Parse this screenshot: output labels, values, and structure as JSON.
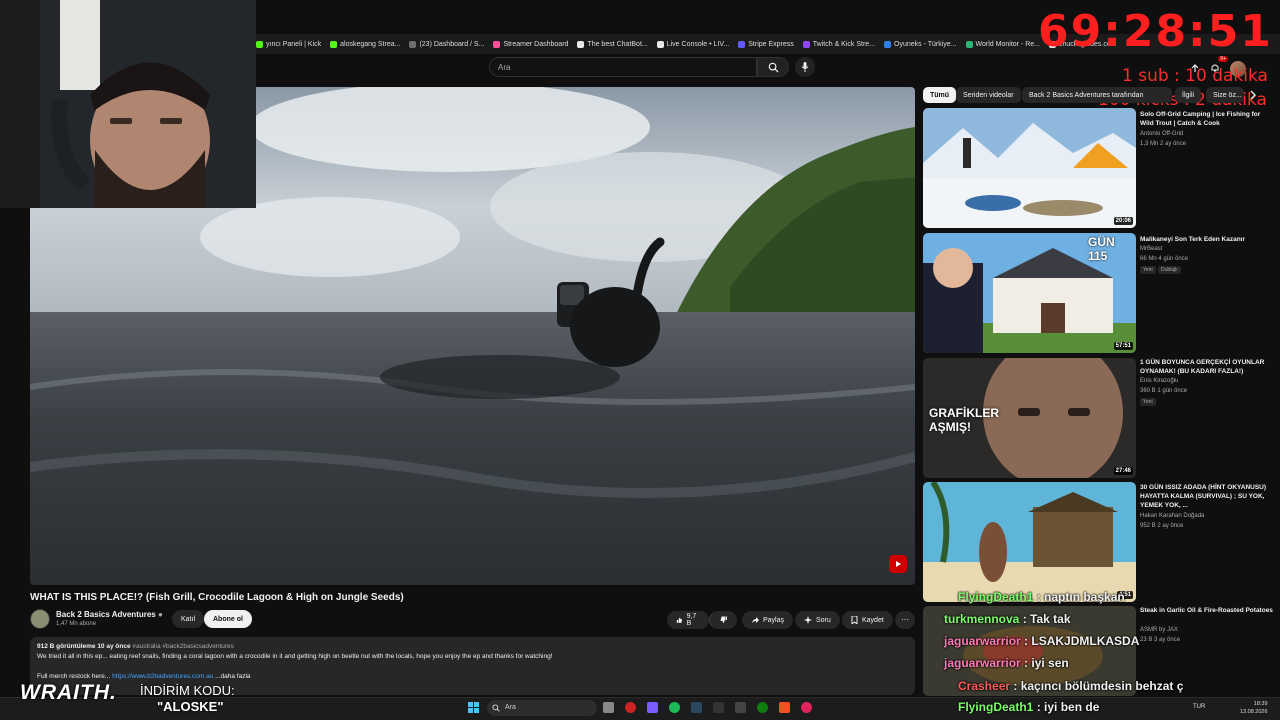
{
  "bookmarks": [
    {
      "label": "yıncı Paneli | Kick",
      "color": "#53fc18"
    },
    {
      "label": "aloskegang Strea...",
      "color": "#53fc18"
    },
    {
      "label": "(23) Dashboard / S...",
      "color": "#6e6e6e"
    },
    {
      "label": "Streamer Dashboard",
      "color": "#ff4f9a"
    },
    {
      "label": "The best ChatBot...",
      "color": "#e8e8e8"
    },
    {
      "label": "Live Console • LIV...",
      "color": "#e8e8e8"
    },
    {
      "label": "Stripe Express",
      "color": "#635bff"
    },
    {
      "label": "Twitch & Kick Stre...",
      "color": "#9146ff"
    },
    {
      "label": "Oyuneks - Türkiye...",
      "color": "#2f80ed"
    },
    {
      "label": "World Monitor - Re...",
      "color": "#2bb673"
    },
    {
      "label": "chucksguides.co...",
      "color": "#e8e8e8"
    }
  ],
  "header": {
    "search_placeholder": "Ara",
    "notif_count": "9+"
  },
  "overlay": {
    "timer": "69:28:51",
    "sub_rule": "1 sub : 10 dakika",
    "kick_rule": "100 kicks : 2 dakika",
    "sponsor": "WRAITH.",
    "promo_label": "İNDİRİM KODU:",
    "promo_code": "\"ALOSKE\""
  },
  "video": {
    "title": "WHAT IS THIS PLACE!? (Fish Grill, Crocodile Lagoon & High on Jungle Seeds)",
    "channel": "Back 2 Basics Adventures",
    "subscribers": "1,47 Mn abone",
    "join_label": "Katıl",
    "subscribe_label": "Abone ol",
    "likes": "9,7 B",
    "share_label": "Paylaş",
    "ask_label": "Soru",
    "save_label": "Kaydet",
    "views_date": "912 B görüntüleme  10 ay önce",
    "hashtags": "#australia #back2basicsadventures",
    "description_line1": "We tried it all in this ep... eating reef snails, finding a coral lagoon with a crocodile in it and getting high on beetle nut with the locals, hope you enjoy the ep and thanks for watching!",
    "description_line2_prefix": "Full merch restock here...",
    "description_link": "https://www.b2badventures.com.au",
    "more_label": "...daha fazla"
  },
  "chips": [
    "Tümü",
    "Seriden videolar",
    "Back 2 Basics Adventures tarafından",
    "İlgili",
    "Size öz..."
  ],
  "recommendations": [
    {
      "title": "Solo Off-Grid Camping | Ice Fishing for Wild Trout | Catch & Cook",
      "channel": "Antonio Off-Grid",
      "meta": "1,3 Mn  2 ay önce",
      "duration": "20:06",
      "badges": []
    },
    {
      "title": "Malikaneyi Son Terk Eden Kazanır",
      "channel": "MrBeast",
      "meta": "66 Mn  4 gün önce",
      "duration": "57:51",
      "badges": [
        "Yeni",
        "Dublajlı"
      ],
      "overlay_text": "GÜN 115"
    },
    {
      "title": "1 GÜN BOYUNCA GERÇEKÇİ OYUNLAR OYNAMAK! (BU KADARI FAZLA!)",
      "channel": "Enis Kirazoğlu",
      "meta": "360 B  1 gün önce",
      "duration": "27:46",
      "badges": [
        "Yeni"
      ],
      "overlay_text": "GRAFİKLER AŞMIŞ!"
    },
    {
      "title": "30 GÜN ISSIZ ADADA (HİNT OKYANUSU) HAYATTA KALMA (SURVIVAL) ; SU YOK, YEMEK YOK, ...",
      "channel": "Hakan Karahan Doğada",
      "meta": "952 B  2 ay önce",
      "duration": "4:51",
      "badges": []
    },
    {
      "title": "Steak in Garlic Oil & Fire-Roasted Potatoes",
      "channel": "ASMR by JAX",
      "meta": "23 B  3 ay önce",
      "duration": "",
      "badges": []
    }
  ],
  "chat": [
    {
      "user": "FlyingDeath1",
      "text": " : naptın başkan",
      "color": "#7dff6a"
    },
    {
      "user": "turkmennova",
      "text": " : Tak tak",
      "color": "#7dff6a"
    },
    {
      "user": "jaguarwarrior",
      "text": " : LSAKJDMLKASDA",
      "color": "#ff7ab8"
    },
    {
      "user": "jaguarwarrior",
      "text": " : iyi sen",
      "color": "#ff7ab8"
    },
    {
      "user": "Crasheer",
      "text": " : kaçıncı bölümdesin behzat ç",
      "color": "#ff5a5a"
    },
    {
      "user": "FlyingDeath1",
      "text": " : iyi ben de",
      "color": "#7dff6a"
    }
  ],
  "taskbar": {
    "search": "Ara",
    "lang": "TUR",
    "time": "18:39",
    "date": "13.08.2026"
  }
}
